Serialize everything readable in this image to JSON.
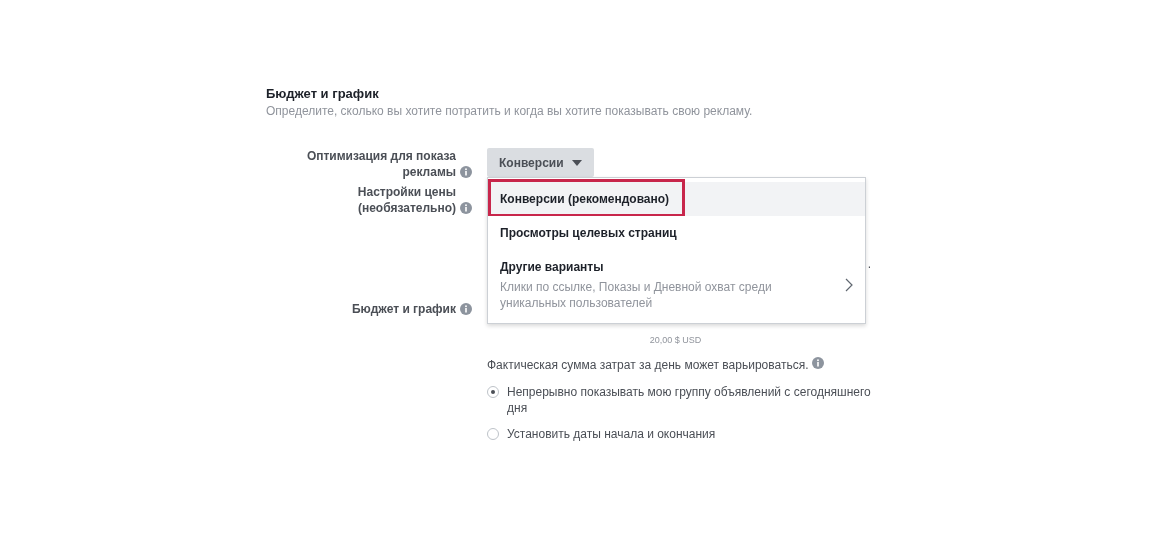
{
  "section": {
    "title": "Бюджет и график",
    "subtitle": "Определите, сколько вы хотите потратить и когда вы хотите показывать свою рекламу."
  },
  "optimization": {
    "label": "Оптимизация для показа рекламы",
    "value": "Конверсии",
    "expanded": true
  },
  "menu": [
    {
      "label": "Конверсии (рекомендовано)",
      "selected": true
    },
    {
      "label": "Просмотры целевых страниц",
      "selected": false
    },
    {
      "label": "Другие варианты",
      "description": "Клики по ссылке, Показы и Дневной охват среди уникальных пользователей",
      "selected": false,
      "submenu": true
    }
  ],
  "pricing": {
    "label": "Настройки цены (необязательно)",
    "hint_tail": "."
  },
  "budget": {
    "label": "Бюджет и график",
    "amount_note": "20,00 $ USD",
    "variation_note": "Фактическая сумма затрат за день может варьироваться."
  },
  "schedule": [
    {
      "label": "Непрерывно показывать мою группу объявлений с сегодняшнего дня",
      "selected": true
    },
    {
      "label": "Установить даты начала и окончания",
      "selected": false
    }
  ]
}
